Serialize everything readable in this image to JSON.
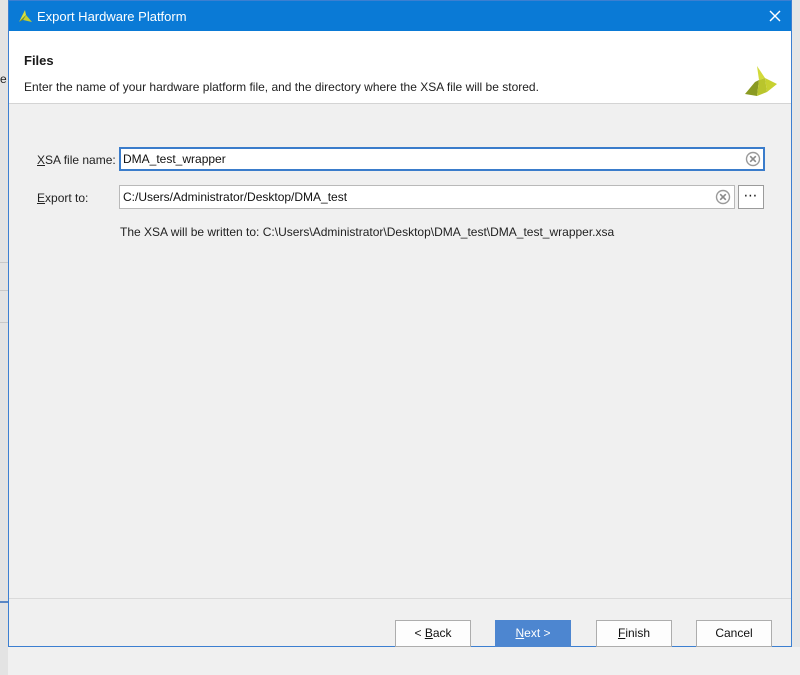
{
  "dialog": {
    "title": "Export Hardware Platform",
    "close_icon": "close-icon",
    "logo_icon": "xilinx-logo-icon"
  },
  "header": {
    "title": "Files",
    "description": "Enter the name of your hardware platform file, and the directory where the XSA file will be stored."
  },
  "form": {
    "xsa_label_mnemonic": "X",
    "xsa_label_rest": "SA file name:",
    "xsa_value": "DMA_test_wrapper",
    "export_label_mnemonic": "E",
    "export_label_rest": "xport to:",
    "export_value": "C:/Users/Administrator/Desktop/DMA_test",
    "browse_label": "⋯",
    "info": "The XSA will be written to: C:\\Users\\Administrator\\Desktop\\DMA_test\\DMA_test_wrapper.xsa"
  },
  "buttons": {
    "back_prefix": "< ",
    "back_mnemonic": "B",
    "back_rest": "ack",
    "next_mnemonic": "N",
    "next_rest": "ext >",
    "finish_mnemonic": "F",
    "finish_rest": "inish",
    "cancel": "Cancel"
  },
  "background": {
    "edge_letter": "e"
  },
  "colors": {
    "titlebar": "#0a7ad6",
    "primary_button": "#4d86d0",
    "focus_border": "#3a7ccb",
    "logo_yellow": "#c9d23a",
    "logo_dark": "#6b7a22"
  }
}
